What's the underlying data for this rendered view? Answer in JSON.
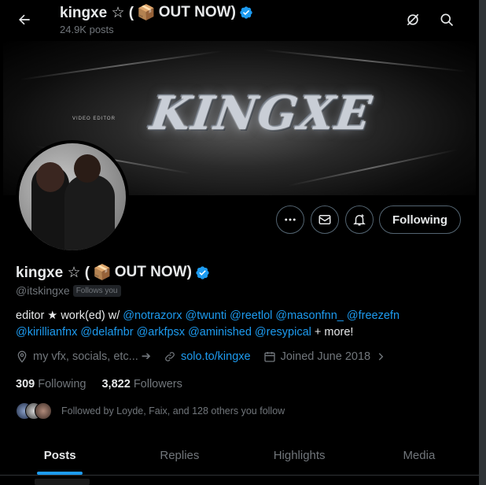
{
  "header": {
    "name_text": "kingxe ☆ (",
    "name_emoji": "📦",
    "name_suffix": "OUT NOW)",
    "posts_count": "24.9K posts"
  },
  "banner": {
    "logo_text": "KINGXE",
    "small_text": "VIDEO EDITOR"
  },
  "actions": {
    "following_label": "Following"
  },
  "profile": {
    "name_text": "kingxe ☆ (",
    "name_emoji": "📦",
    "name_suffix": "OUT NOW)",
    "handle": "@itskingxe",
    "follows_you": "Follows you",
    "bio_prefix": "editor ★ work(ed) w/ ",
    "mentions": [
      "@notrazorx",
      "@twunti",
      "@reetlol",
      "@masonfnn_",
      "@freezefn",
      "@kirillianfnx",
      "@delafnbr",
      "@arkfpsx",
      "@aminished",
      "@resypical"
    ],
    "bio_suffix": " + more!",
    "location": "my vfx, socials, etc... ➔",
    "website": "solo.to/kingxe",
    "joined": "Joined June 2018",
    "following_count": "309",
    "following_label": "Following",
    "followers_count": "3,822",
    "followers_label": "Followers",
    "followed_by": "Followed by Loyde, Faix, and 128 others you follow"
  },
  "tabs": [
    "Posts",
    "Replies",
    "Highlights",
    "Media"
  ],
  "colors": {
    "accent": "#1d9bf0",
    "muted": "#71767b",
    "text": "#e7e9ea",
    "background": "#000000"
  }
}
